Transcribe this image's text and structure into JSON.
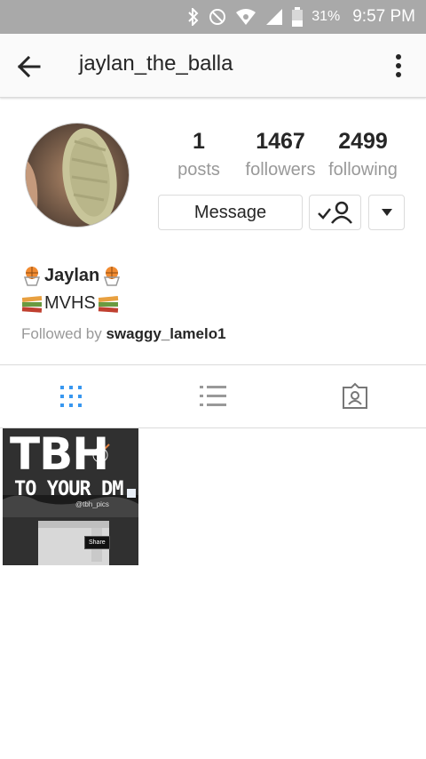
{
  "status_bar": {
    "battery_percent": "31%",
    "time": "9:57 PM",
    "icons": [
      "bluetooth-icon",
      "do-not-disturb-icon",
      "wifi-icon",
      "signal-icon",
      "battery-icon"
    ]
  },
  "header": {
    "back_icon": "arrow-left-icon",
    "username": "jaylan_the_balla",
    "overflow_icon": "more-vertical-icon"
  },
  "profile": {
    "stats": [
      {
        "value": "1",
        "label": "posts"
      },
      {
        "value": "1467",
        "label": "followers"
      },
      {
        "value": "2499",
        "label": "following"
      }
    ],
    "message_label": "Message",
    "follow_icon": "following-check-icon",
    "dropdown_icon": "caret-down-icon"
  },
  "bio": {
    "name": "Jaylan",
    "name_emoji": "basketball-hoop-emoji",
    "line": "MVHS",
    "line_emoji": "books-emoji",
    "followed_by_prefix": "Followed by ",
    "followed_by_user": "swaggy_lamelo1"
  },
  "tabs": [
    {
      "icon": "grid-icon",
      "active": true
    },
    {
      "icon": "list-icon",
      "active": false
    },
    {
      "icon": "tagged-icon",
      "active": false
    }
  ],
  "posts": [
    {
      "title": "TBH",
      "subtitle": "TO YOUR DM",
      "handle": "@tbh_pics",
      "share_label": "Share"
    }
  ],
  "colors": {
    "status_bar": "#a9a9a9",
    "text_primary": "#262626",
    "text_secondary": "#999999",
    "accent_blue": "#3897f0",
    "border": "#dbdbdb"
  }
}
